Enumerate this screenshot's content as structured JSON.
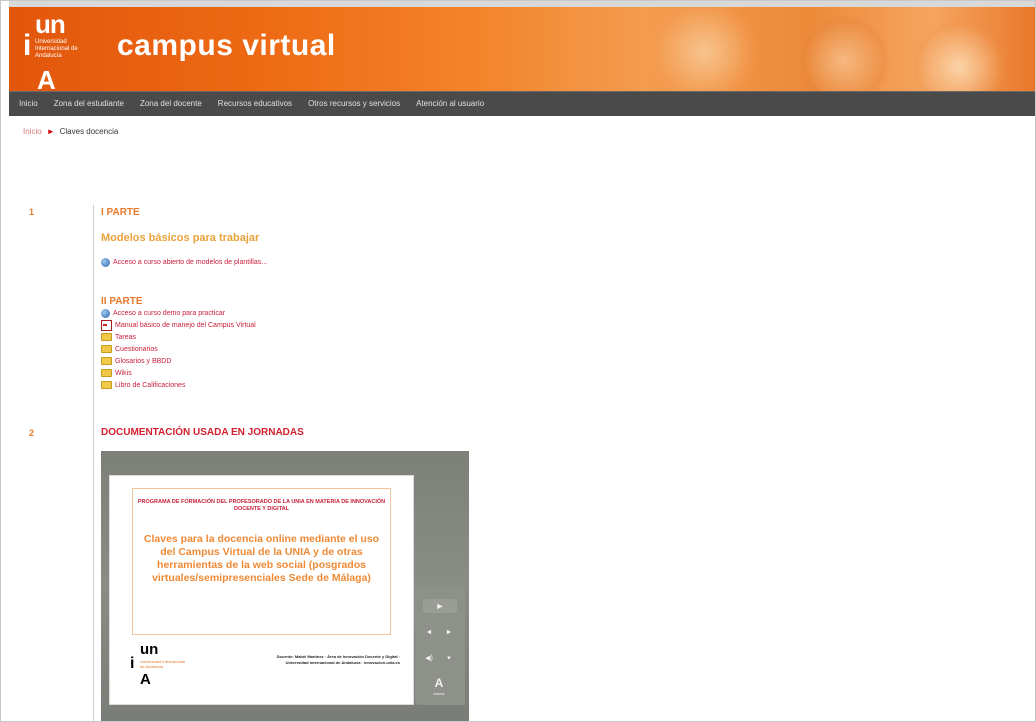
{
  "header": {
    "logo_un": "un",
    "logo_i": "i",
    "logo_small": "Universidad Internacional de Andalucía",
    "logo_A": "A",
    "site_title": "campus virtual"
  },
  "nav": {
    "items": [
      {
        "label": "Inicio"
      },
      {
        "label": "Zona del estudiante"
      },
      {
        "label": "Zona del docente"
      },
      {
        "label": "Recursos educativos"
      },
      {
        "label": "Otros recursos y servicios"
      },
      {
        "label": "Atención al usuario"
      }
    ]
  },
  "breadcrumb": {
    "home": "Inicio",
    "arrow": "►",
    "current": "Claves docencia"
  },
  "section1": {
    "number": "1",
    "part_title": "I PARTE",
    "subtitle": "Modelos básicos para trabajar",
    "link": "Acceso a curso abierto de modelos de plantillas..."
  },
  "section1b": {
    "part_title": "II PARTE",
    "links": [
      {
        "label": "Acceso a curso demo para practicar",
        "icon": "globe-icon"
      },
      {
        "label": "Manual básico de manejo del Campus Virtual",
        "icon": "pdf-icon"
      },
      {
        "label": "Tareas",
        "icon": "folder-icon"
      },
      {
        "label": "Cuestionarios",
        "icon": "folder-icon"
      },
      {
        "label": "Glosarios y BBDD",
        "icon": "folder-icon"
      },
      {
        "label": "Wikis",
        "icon": "folder-icon"
      },
      {
        "label": "Libro de Calificaciones",
        "icon": "folder-icon"
      }
    ]
  },
  "section2": {
    "number": "2",
    "title": "DOCUMENTACIÓN USADA EN JORNADAS"
  },
  "slide": {
    "red_text": "PROGRAMA DE FORMACIÓN DEL PROFESORADO DE LA UNIA EN MATERIA DE INNOVACIÓN DOCENTE Y DIGITAL",
    "main_text": "Claves para la docencia online mediante el uso del Campus Virtual de la UNIA y de otras herramientas de la web social (posgrados virtuales/semipresenciales Sede de Málaga)",
    "logo_un": "un",
    "logo_i": "i",
    "logo_small": "Universidad Internacional de Andalucía",
    "logo_A": "A",
    "credits": "Docente: Mabel Martínez · Área de Innovación Docente y Digital · Universidad Internacional de Andalucía · innovacion.unia.es"
  },
  "player": {
    "play": "►",
    "prev": "◄",
    "next": "►",
    "volume": "◀)",
    "options": "▾",
    "adobe_mark": "A",
    "adobe_label": "Adobe"
  },
  "colors": {
    "header_orange": "#ee6a14",
    "nav_bg": "#4a4a4a",
    "link_red": "#c81e3a",
    "heading_orange": "#e8782a"
  }
}
